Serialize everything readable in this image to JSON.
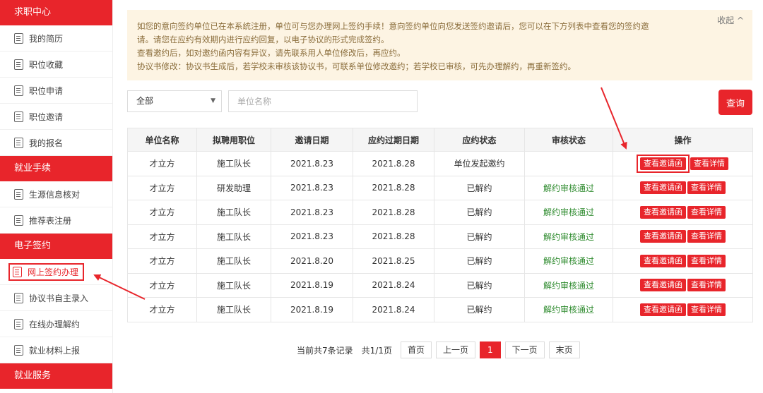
{
  "sidebar": {
    "sections": [
      {
        "title": "求职中心",
        "items": [
          "我的简历",
          "职位收藏",
          "职位申请",
          "职位邀请",
          "我的报名"
        ]
      },
      {
        "title": "就业手续",
        "items": [
          "生源信息核对",
          "推荐表注册"
        ]
      },
      {
        "title": "电子签约",
        "items": [
          "网上签约办理",
          "协议书自主录入",
          "在线办理解约",
          "就业材料上报"
        ]
      },
      {
        "title": "就业服务",
        "items": []
      }
    ],
    "active_item": "网上签约办理"
  },
  "notice": {
    "lines": [
      "如您的意向签约单位已在本系统注册，单位可与您办理网上签约手续！意向签约单位向您发送签约邀请后，您可以在下方列表中查看您的签约邀",
      "请。请您在应约有效期内进行应约回复，以电子协议的形式完成签约。",
      "查看邀约后，如对邀约函内容有异议，请先联系用人单位修改后，再应约。",
      "协议书修改：协议书生成后，若学校未审核该协议书，可联系单位修改邀约；若学校已审核，可先办理解约，再重新签约。"
    ],
    "collapse_label": "收起 ^"
  },
  "filters": {
    "status_select_value": "全部",
    "search_placeholder": "单位名称",
    "query_label": "查询"
  },
  "table": {
    "headers": [
      "单位名称",
      "拟聘用职位",
      "邀请日期",
      "应约过期日期",
      "应约状态",
      "审核状态",
      "操作"
    ],
    "view_invite_label": "查看邀请函",
    "view_detail_label": "查看详情",
    "rows": [
      {
        "company": "才立方",
        "position": "施工队长",
        "invite_date": "2021.8.23",
        "expire_date": "2021.8.28",
        "status": "单位发起邀约",
        "audit": ""
      },
      {
        "company": "才立方",
        "position": "研发助理",
        "invite_date": "2021.8.23",
        "expire_date": "2021.8.28",
        "status": "已解约",
        "audit": "解约审核通过"
      },
      {
        "company": "才立方",
        "position": "施工队长",
        "invite_date": "2021.8.23",
        "expire_date": "2021.8.28",
        "status": "已解约",
        "audit": "解约审核通过"
      },
      {
        "company": "才立方",
        "position": "施工队长",
        "invite_date": "2021.8.23",
        "expire_date": "2021.8.28",
        "status": "已解约",
        "audit": "解约审核通过"
      },
      {
        "company": "才立方",
        "position": "施工队长",
        "invite_date": "2021.8.20",
        "expire_date": "2021.8.25",
        "status": "已解约",
        "audit": "解约审核通过"
      },
      {
        "company": "才立方",
        "position": "施工队长",
        "invite_date": "2021.8.19",
        "expire_date": "2021.8.24",
        "status": "已解约",
        "audit": "解约审核通过"
      },
      {
        "company": "才立方",
        "position": "施工队长",
        "invite_date": "2021.8.19",
        "expire_date": "2021.8.24",
        "status": "已解约",
        "audit": "解约审核通过"
      }
    ]
  },
  "pagination": {
    "summary": "当前共7条记录",
    "page_info": "共1/1页",
    "first_label": "首页",
    "prev_label": "上一页",
    "current_page": "1",
    "next_label": "下一页",
    "last_label": "末页"
  },
  "colors": {
    "accent": "#e8252b",
    "notice_bg": "#fdf4e3",
    "audit_ok": "#2e8b2e"
  }
}
